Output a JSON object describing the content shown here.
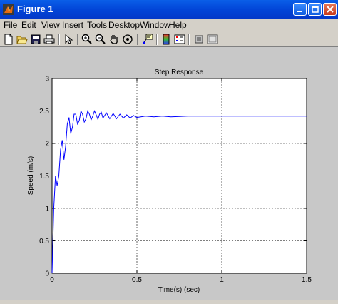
{
  "window": {
    "title": "Figure 1"
  },
  "menu": [
    "File",
    "Edit",
    "View",
    "Insert",
    "Tools",
    "Desktop",
    "Window",
    "Help"
  ],
  "toolbar": [
    "new-file",
    "open-file",
    "save",
    "print",
    "select-arrow",
    "zoom-in",
    "zoom-out",
    "pan",
    "rotate-3d",
    "data-cursor",
    "colorbar",
    "legend",
    "hide-plot-tools",
    "show-plot-tools"
  ],
  "chart_data": {
    "type": "line",
    "title": "Step Response",
    "xlabel": "Time(s) (sec)",
    "ylabel": "Speed (m/s)",
    "xlim": [
      0,
      1.5
    ],
    "ylim": [
      0,
      3
    ],
    "xticks": [
      "0",
      "0.5",
      "1",
      "1.5"
    ],
    "yticks": [
      "0",
      "0.5",
      "1",
      "1.5",
      "2",
      "2.5",
      "3"
    ],
    "grid": true,
    "line_color": "#0000ff",
    "series": [
      {
        "x": [
          0,
          0.01,
          0.02,
          0.03,
          0.04,
          0.05,
          0.06,
          0.07,
          0.08,
          0.09,
          0.1,
          0.11,
          0.12,
          0.13,
          0.14,
          0.15,
          0.16,
          0.17,
          0.18,
          0.19,
          0.2,
          0.21,
          0.22,
          0.23,
          0.24,
          0.25,
          0.26,
          0.27,
          0.28,
          0.29,
          0.3,
          0.32,
          0.34,
          0.36,
          0.38,
          0.4,
          0.42,
          0.44,
          0.46,
          0.48,
          0.5,
          0.55,
          0.6,
          0.65,
          0.7,
          0.8,
          0.9,
          1.0,
          1.2,
          1.5
        ],
        "y": [
          0,
          1.0,
          1.5,
          1.35,
          1.5,
          1.9,
          2.05,
          1.75,
          1.95,
          2.3,
          2.4,
          2.15,
          2.25,
          2.45,
          2.45,
          2.3,
          2.35,
          2.5,
          2.45,
          2.33,
          2.38,
          2.5,
          2.45,
          2.36,
          2.42,
          2.5,
          2.44,
          2.37,
          2.45,
          2.48,
          2.39,
          2.47,
          2.38,
          2.46,
          2.38,
          2.45,
          2.39,
          2.44,
          2.39,
          2.43,
          2.4,
          2.42,
          2.41,
          2.42,
          2.41,
          2.42,
          2.42,
          2.42,
          2.42,
          2.42
        ]
      }
    ]
  }
}
